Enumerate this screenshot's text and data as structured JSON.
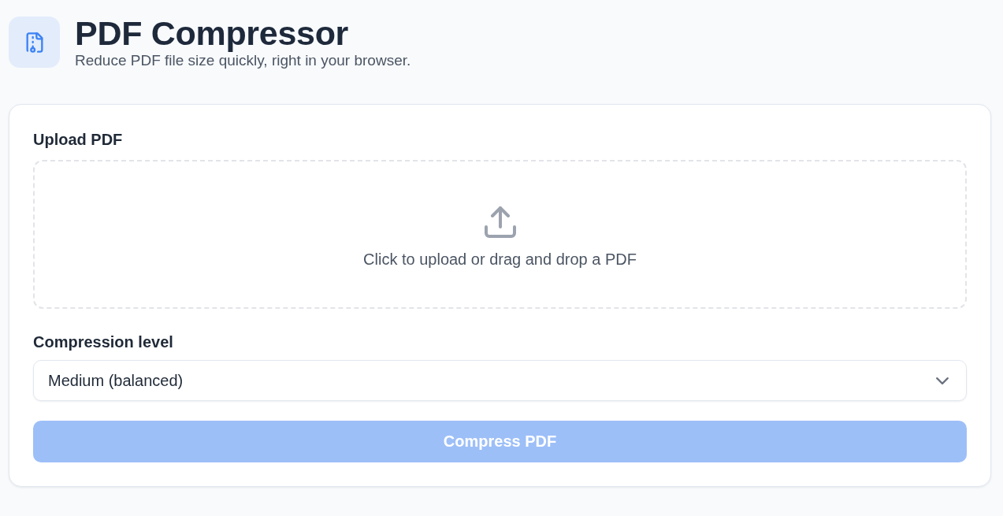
{
  "header": {
    "title": "PDF Compressor",
    "subtitle": "Reduce PDF file size quickly, right in your browser."
  },
  "upload": {
    "label": "Upload PDF",
    "prompt": "Click to upload or drag and drop a PDF"
  },
  "compression": {
    "label": "Compression level",
    "value": "Medium (balanced)"
  },
  "compress_button": {
    "label": "Compress PDF",
    "disabled": true
  }
}
